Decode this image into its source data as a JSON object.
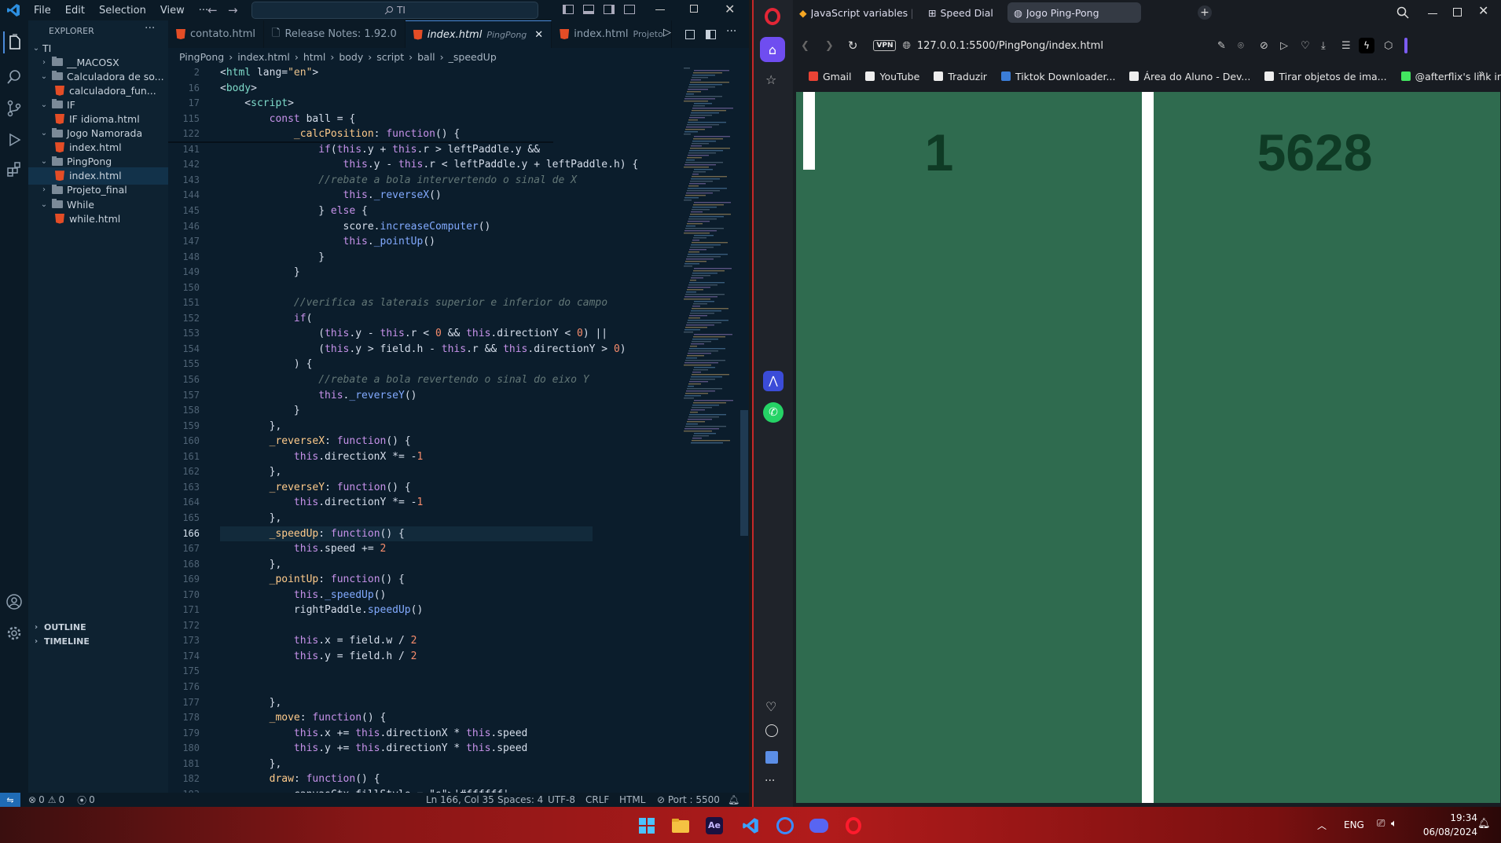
{
  "vscode": {
    "menu": [
      "File",
      "Edit",
      "Selection",
      "View",
      "···"
    ],
    "search_text": "TI",
    "explorer_title": "EXPLORER",
    "root": "TI",
    "tree": [
      {
        "label": "__MACOSX",
        "type": "folder",
        "open": false,
        "depth": 1
      },
      {
        "label": "Calculadora de so...",
        "type": "folder",
        "open": true,
        "depth": 1
      },
      {
        "label": "calculadora_fun...",
        "type": "file",
        "depth": 2
      },
      {
        "label": "IF",
        "type": "folder",
        "open": true,
        "depth": 1
      },
      {
        "label": "IF idioma.html",
        "type": "file",
        "depth": 2
      },
      {
        "label": "Jogo Namorada",
        "type": "folder",
        "open": true,
        "depth": 1
      },
      {
        "label": "index.html",
        "type": "file",
        "depth": 2
      },
      {
        "label": "PingPong",
        "type": "folder",
        "open": true,
        "depth": 1
      },
      {
        "label": "index.html",
        "type": "file",
        "depth": 2,
        "selected": true
      },
      {
        "label": "Projeto_final",
        "type": "folder",
        "open": false,
        "depth": 1
      },
      {
        "label": "While",
        "type": "folder",
        "open": true,
        "depth": 1
      },
      {
        "label": "while.html",
        "type": "file",
        "depth": 2
      }
    ],
    "outline_label": "OUTLINE",
    "timeline_label": "TIMELINE",
    "tabs": [
      {
        "label": "contato.html",
        "hint": ""
      },
      {
        "label": "Release Notes: 1.92.0",
        "hint": ""
      },
      {
        "label": "index.html",
        "hint": "PingPong",
        "active": true
      },
      {
        "label": "index.html",
        "hint": "Projeto"
      }
    ],
    "breadcrumb": [
      "PingPong",
      "index.html",
      "html",
      "body",
      "script",
      "ball",
      "_speedUp"
    ],
    "sticky": [
      {
        "n": "2",
        "code": "<html lang=\"en\">"
      },
      {
        "n": "16",
        "code": "<body>"
      },
      {
        "n": "17",
        "code": "    <script>"
      },
      {
        "n": "115",
        "code": "        const ball = {"
      },
      {
        "n": "122",
        "code": "            _calcPosition: function() {"
      }
    ],
    "lines": [
      {
        "n": "141",
        "code": "                if(this.y + this.r > leftPaddle.y &&"
      },
      {
        "n": "142",
        "code": "                    this.y - this.r < leftPaddle.y + leftPaddle.h) {"
      },
      {
        "n": "143",
        "code": "                //rebate a bola intervertendo o sinal de X",
        "comment": true
      },
      {
        "n": "144",
        "code": "                    this._reverseX()"
      },
      {
        "n": "145",
        "code": "                } else {"
      },
      {
        "n": "146",
        "code": "                    score.increaseComputer()"
      },
      {
        "n": "147",
        "code": "                    this._pointUp()"
      },
      {
        "n": "148",
        "code": "                }"
      },
      {
        "n": "149",
        "code": "            }"
      },
      {
        "n": "150",
        "code": ""
      },
      {
        "n": "151",
        "code": "            //verifica as laterais superior e inferior do campo",
        "comment": true
      },
      {
        "n": "152",
        "code": "            if("
      },
      {
        "n": "153",
        "code": "                (this.y - this.r < 0 && this.directionY < 0) ||"
      },
      {
        "n": "154",
        "code": "                (this.y > field.h - this.r && this.directionY > 0)"
      },
      {
        "n": "155",
        "code": "            ) {"
      },
      {
        "n": "156",
        "code": "                //rebate a bola revertendo o sinal do eixo Y",
        "comment": true
      },
      {
        "n": "157",
        "code": "                this._reverseY()"
      },
      {
        "n": "158",
        "code": "            }"
      },
      {
        "n": "159",
        "code": "        },"
      },
      {
        "n": "160",
        "code": "        _reverseX: function() {"
      },
      {
        "n": "161",
        "code": "            this.directionX *= -1"
      },
      {
        "n": "162",
        "code": "        },"
      },
      {
        "n": "163",
        "code": "        _reverseY: function() {"
      },
      {
        "n": "164",
        "code": "            this.directionY *= -1"
      },
      {
        "n": "165",
        "code": "        },"
      },
      {
        "n": "166",
        "code": "        _speedUp: function() {",
        "current": true
      },
      {
        "n": "167",
        "code": "            this.speed += 2"
      },
      {
        "n": "168",
        "code": "        },"
      },
      {
        "n": "169",
        "code": "        _pointUp: function() {"
      },
      {
        "n": "170",
        "code": "            this._speedUp()"
      },
      {
        "n": "171",
        "code": "            rightPaddle.speedUp()"
      },
      {
        "n": "172",
        "code": ""
      },
      {
        "n": "173",
        "code": "            this.x = field.w / 2"
      },
      {
        "n": "174",
        "code": "            this.y = field.h / 2"
      },
      {
        "n": "175",
        "code": ""
      },
      {
        "n": "176",
        "code": ""
      },
      {
        "n": "177",
        "code": "        },"
      },
      {
        "n": "178",
        "code": "        _move: function() {"
      },
      {
        "n": "179",
        "code": "            this.x += this.directionX * this.speed"
      },
      {
        "n": "180",
        "code": "            this.y += this.directionY * this.speed"
      },
      {
        "n": "181",
        "code": "        },"
      },
      {
        "n": "182",
        "code": "        draw: function() {"
      },
      {
        "n": "183",
        "code": "            canvasCtx.fillStyle = '#ffffff'"
      }
    ],
    "status": {
      "errors": "0",
      "warnings": "0",
      "ports": "0",
      "position": "Ln 166, Col 35",
      "spaces": "Spaces: 4",
      "encoding": "UTF-8",
      "eol": "CRLF",
      "language": "HTML",
      "port": "Port : 5500"
    }
  },
  "opera": {
    "tabs": [
      {
        "label": "JavaScript variables | JSch",
        "icon": "diamond-icon"
      },
      {
        "label": "Speed Dial",
        "icon": "grid-icon"
      },
      {
        "label": "Jogo Ping-Pong",
        "icon": "globe-icon",
        "active": true
      }
    ],
    "vpn": "VPN",
    "url": "127.0.0.1:5500/PingPong/index.html",
    "bookmarks": [
      "Gmail",
      "YouTube",
      "Traduzir",
      "Tiktok Downloader...",
      "Área do Aluno - Dev...",
      "Tirar objetos de ima...",
      "@afterflix's link in bi..."
    ],
    "game": {
      "score_left": "1",
      "score_right": "5628",
      "field_color": "#2f6b4f",
      "score_color": "#0f3b25",
      "paddle_color": "#ffffff"
    }
  },
  "taskbar": {
    "lang": "ENG",
    "time": "19:34",
    "date": "06/08/2024"
  }
}
